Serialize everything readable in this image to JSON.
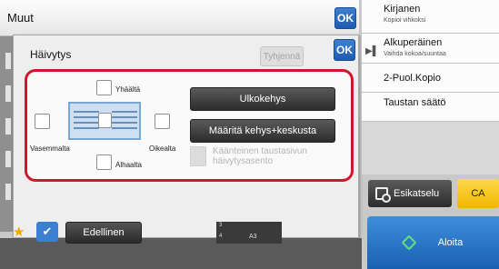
{
  "topbar": {
    "title": "Muut",
    "ok_label": "OK"
  },
  "dialog": {
    "title": "Häivytys",
    "ok_label": "OK",
    "clear_label": "Tyhjennä",
    "positions": {
      "top": "Yhäältä",
      "left": "Vasemmalta",
      "right": "Oikealta",
      "bottom": "Alhaalta"
    },
    "frame_button": "Ulkokehys",
    "frame_center_button": "Määritä kehys+keskusta",
    "reverse_option": "Käänteinen taustasivun häivytysasento"
  },
  "right_panel": {
    "items": [
      {
        "label": "Kirjanen",
        "sub": "Kopioi vihkoksi"
      },
      {
        "label": "Alkuperäinen",
        "sub": "Vaihda kokoa/suuntaa"
      },
      {
        "label": "2-Puol.Kopio",
        "sub": ""
      },
      {
        "label": "Taustan säätö",
        "sub": ""
      }
    ]
  },
  "actions": {
    "preview": "Esikatselu",
    "ca": "CA",
    "start": "Aloita",
    "previous": "Edellinen"
  },
  "tray": {
    "n1": "3",
    "n2": "4",
    "size": "A3"
  },
  "colors": {
    "highlight_frame": "#d2142d",
    "ok_blue": "#2a6cc0",
    "ca_yellow": "#f5c20c"
  }
}
